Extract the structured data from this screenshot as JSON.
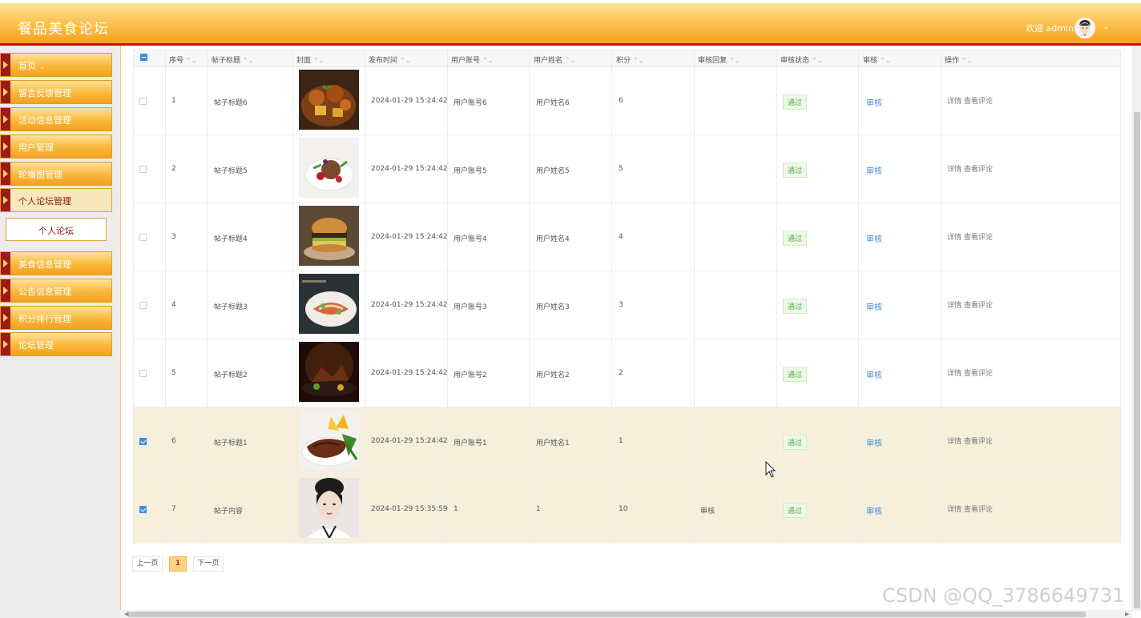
{
  "header": {
    "title": "餐品美食论坛",
    "welcome": "欢迎 admin",
    "caret": "⌄"
  },
  "sidebar": {
    "items": [
      {
        "label": "首页",
        "suffix": "⌄"
      },
      {
        "label": "留言反馈管理"
      },
      {
        "label": "活动信息管理"
      },
      {
        "label": "用户管理"
      },
      {
        "label": "轮播图管理"
      },
      {
        "label": "个人论坛管理",
        "active": true
      },
      {
        "label": "美食信息管理"
      },
      {
        "label": "公告信息管理"
      },
      {
        "label": "积分排行管理"
      },
      {
        "label": "论坛管理"
      }
    ],
    "submenu": "个人论坛"
  },
  "table": {
    "columns": [
      "序号",
      "帖子标题",
      "封面",
      "发布时间",
      "用户账号",
      "用户姓名",
      "积分",
      "审核回复",
      "审核状态",
      "审核",
      "操作"
    ],
    "sort_icon": "⌃⌄",
    "rows": [
      {
        "index": "1",
        "title": "帖子标题6",
        "time": "2024-01-29 15:24:42",
        "account": "用户账号6",
        "name": "用户姓名6",
        "points": "6",
        "reply": "",
        "status": "通过",
        "audit": "审核",
        "ops": "详情 查看评论",
        "checked": false,
        "thumb": "food-dish-1"
      },
      {
        "index": "2",
        "title": "帖子标题5",
        "time": "2024-01-29 15:24:42",
        "account": "用户账号5",
        "name": "用户姓名5",
        "points": "5",
        "reply": "",
        "status": "通过",
        "audit": "审核",
        "ops": "详情 查看评论",
        "checked": false,
        "thumb": "food-dish-2"
      },
      {
        "index": "3",
        "title": "帖子标题4",
        "time": "2024-01-29 15:24:42",
        "account": "用户账号4",
        "name": "用户姓名4",
        "points": "4",
        "reply": "",
        "status": "通过",
        "audit": "审核",
        "ops": "详情 查看评论",
        "checked": false,
        "thumb": "food-burger"
      },
      {
        "index": "4",
        "title": "帖子标题3",
        "time": "2024-01-29 15:24:42",
        "account": "用户账号3",
        "name": "用户姓名3",
        "points": "3",
        "reply": "",
        "status": "通过",
        "audit": "审核",
        "ops": "详情 查看评论",
        "checked": false,
        "thumb": "food-plate"
      },
      {
        "index": "5",
        "title": "帖子标题2",
        "time": "2024-01-29 15:24:42",
        "account": "用户账号2",
        "name": "用户姓名2",
        "points": "2",
        "reply": "",
        "status": "通过",
        "audit": "审核",
        "ops": "详情 查看评论",
        "checked": false,
        "thumb": "food-meat-dark"
      },
      {
        "index": "6",
        "title": "帖子标题1",
        "time": "2024-01-29 15:24:42",
        "account": "用户账号1",
        "name": "用户姓名1",
        "points": "1",
        "reply": "",
        "status": "通过",
        "audit": "审核",
        "ops": "详情 查看评论",
        "checked": true,
        "thumb": "food-steak"
      },
      {
        "index": "7",
        "title": "帖子内容",
        "time": "2024-01-29 15:35:59",
        "account": "1",
        "name": "1",
        "points": "10",
        "reply": "审核",
        "status": "通过",
        "audit": "审核",
        "ops": "详情 查看评论",
        "checked": true,
        "thumb": "portrait-woman"
      }
    ]
  },
  "pager": {
    "prev": "上一页",
    "current": "1",
    "next": "下一页"
  },
  "watermark": "CSDN @QQ_3786649731",
  "colors": {
    "header_orange": "#f6a21c",
    "header_red_line": "#b8180b",
    "menu_arrow": "#9c1b14",
    "status_green": "#4fb13b",
    "link_blue": "#3c8dd6",
    "selected_row": "#f6efdc"
  }
}
